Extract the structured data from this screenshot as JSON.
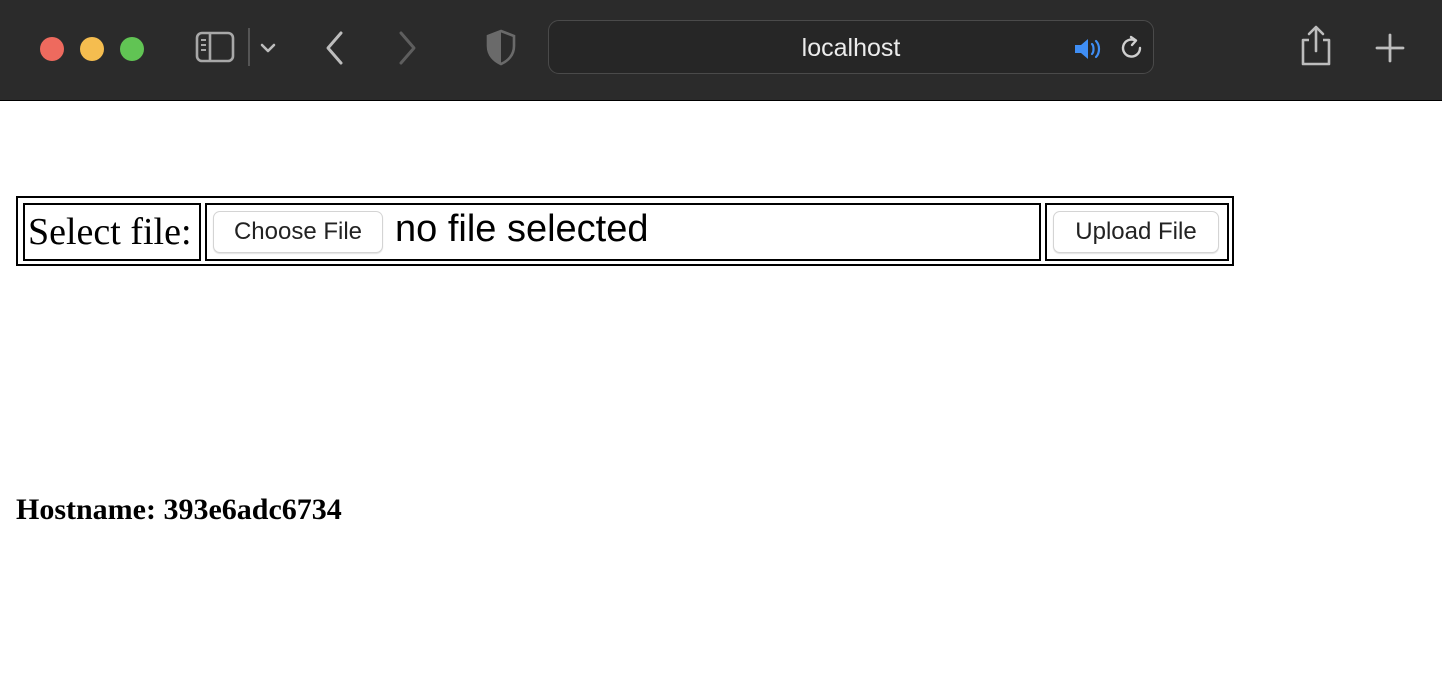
{
  "browser": {
    "address": "localhost",
    "icons": [
      "sidebar-icon",
      "chevron-down-icon",
      "back-icon",
      "forward-icon",
      "privacy-shield-icon",
      "speaker-icon",
      "reload-icon",
      "share-icon",
      "new-tab-icon"
    ],
    "colors": {
      "toolbar": "#2b2b2b",
      "close": "#ee6a5e",
      "minimize": "#f5bd4f",
      "zoom": "#61c454",
      "speaker": "#3f8ef5"
    }
  },
  "upload_form": {
    "label": "Select file:",
    "choose_button": "Choose File",
    "file_status": "no file selected",
    "upload_button": "Upload File"
  },
  "hostname": "Hostname: 393e6adc6734"
}
